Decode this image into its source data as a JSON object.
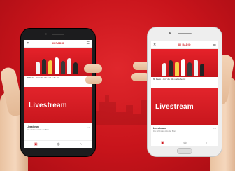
{
  "colors": {
    "background": "#c8141b",
    "accent": "#d01a20"
  },
  "phones": [
    {
      "id": "left",
      "header": {
        "close_icon": "close-icon",
        "logo": "80 RADIO",
        "menu_icon": "menu-icon"
      },
      "promo_caption": "80 Radio – Hör’ die Hits und Lebe nix",
      "stream_label": "Livestream",
      "list_item": {
        "title": "Livestream",
        "subtitle": "Die schönsten Hits der 80er"
      },
      "bottom_nav": [
        "radio-icon",
        "globe-icon",
        "headphones-icon"
      ]
    },
    {
      "id": "right",
      "header": {
        "close_icon": "close-icon",
        "logo": "80 RADIO",
        "menu_icon": "menu-icon"
      },
      "promo_caption": "80 Radio – Hör’ die Hits und Lebe nix",
      "stream_label": "Livestream",
      "list_item": {
        "title": "Livestream",
        "subtitle": "Die schönsten Hits der 80er"
      },
      "bottom_nav": [
        "radio-icon",
        "globe-icon",
        "headphones-icon"
      ]
    }
  ]
}
